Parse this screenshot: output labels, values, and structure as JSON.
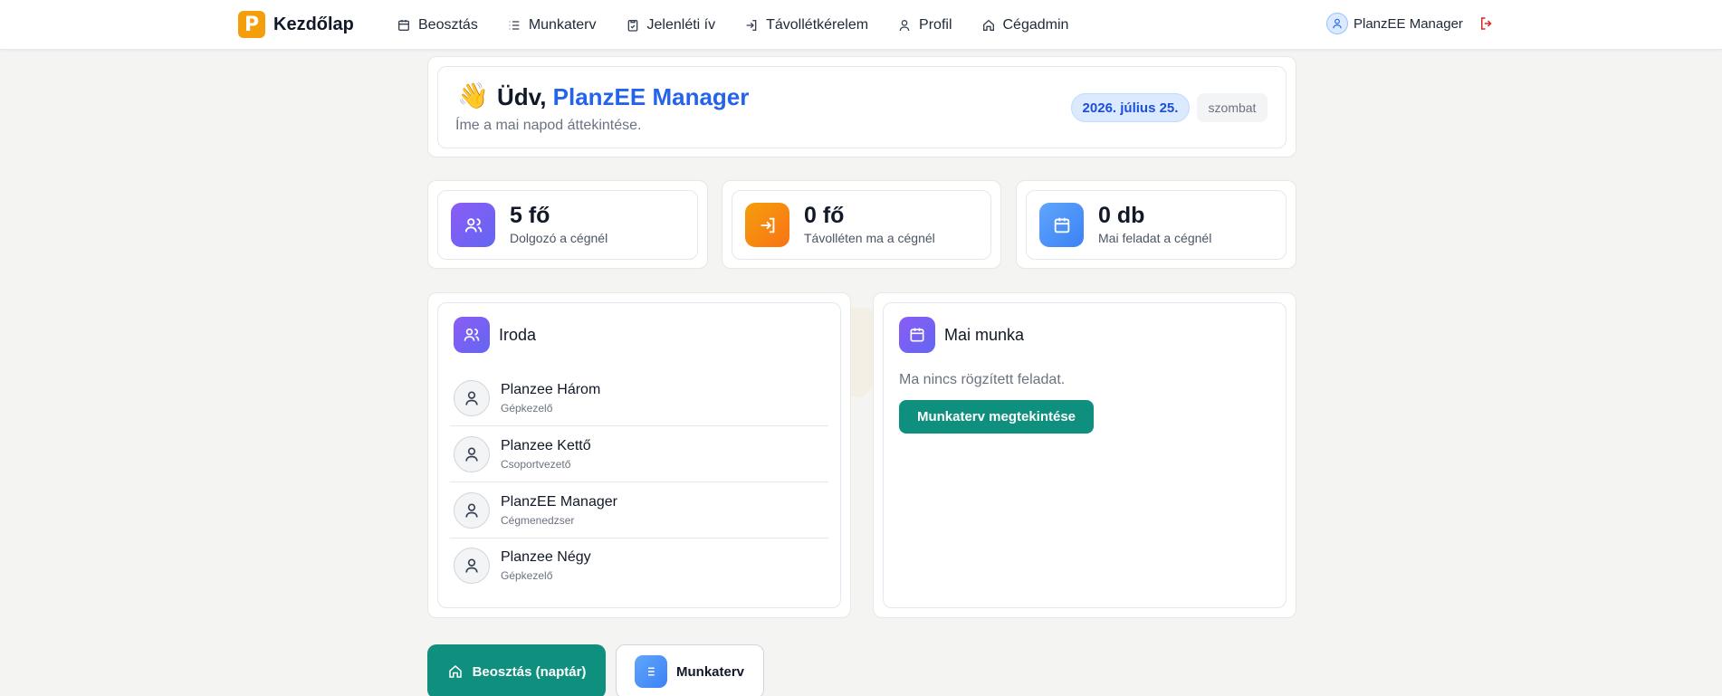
{
  "nav": {
    "brand_letter": "P",
    "brand_name": "Kezdőlap",
    "items": [
      {
        "label": "Beosztás",
        "icon": "calendar-icon"
      },
      {
        "label": "Munkaterv",
        "icon": "list-icon"
      },
      {
        "label": "Jelenléti ív",
        "icon": "clipboard-icon"
      },
      {
        "label": "Távollétkérelem",
        "icon": "login-arrow-icon"
      },
      {
        "label": "Profil",
        "icon": "user-icon"
      },
      {
        "label": "Cégadmin",
        "icon": "home-icon"
      }
    ],
    "user_name": "PlanzEE Manager"
  },
  "welcome": {
    "wave": "👋",
    "greeting_prefix": "Üdv, ",
    "greeting_name": "PlanzEE Manager",
    "subtitle": "Íme a mai napod áttekintése.",
    "date": "2026. július 25.",
    "weekday": "szombat"
  },
  "stats": [
    {
      "value": "5 fő",
      "label": "Dolgozó a cégnél",
      "icon": "users-icon",
      "color": "#7c5cf2"
    },
    {
      "value": "0 fő",
      "label": "Távolléten ma a cégnél",
      "icon": "login-arrow-icon",
      "color": "#f59e0b"
    },
    {
      "value": "0 db",
      "label": "Mai feladat a cégnél",
      "icon": "calendar-icon",
      "color": "#3b82f6"
    }
  ],
  "team": {
    "title": "Iroda",
    "members": [
      {
        "name": "Planzee Három",
        "role": "Gépkezelő"
      },
      {
        "name": "Planzee Kettő",
        "role": "Csoportvezető"
      },
      {
        "name": "PlanzEE Manager",
        "role": "Cégmenedzser"
      },
      {
        "name": "Planzee Négy",
        "role": "Gépkezelő"
      }
    ]
  },
  "today": {
    "title": "Mai munka",
    "empty_text": "Ma nincs rögzített feladat.",
    "button": "Munkaterv megtekintése"
  },
  "bottom": {
    "schedule_button": "Beosztás (naptár)",
    "plan_button": "Munkaterv"
  },
  "colors": {
    "accent_blue": "#2563eb",
    "teal": "#0f8f7e",
    "logout_red": "#dc2626"
  }
}
